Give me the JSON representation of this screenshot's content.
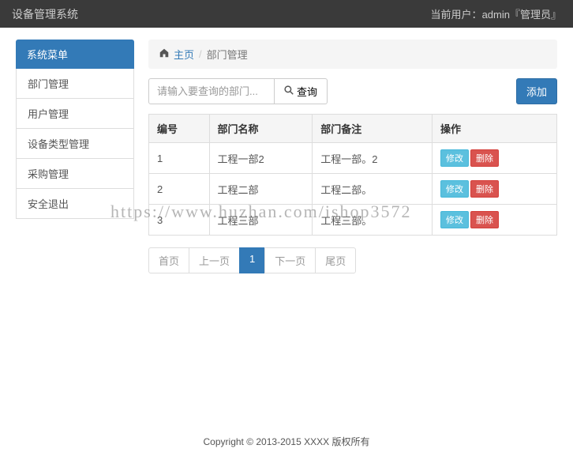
{
  "navbar": {
    "brand": "设备管理系统",
    "user_prefix": "当前用户：",
    "user_name": "admin",
    "user_role": "『管理员』"
  },
  "sidebar": {
    "header": "系统菜单",
    "items": [
      {
        "label": "部门管理"
      },
      {
        "label": "用户管理"
      },
      {
        "label": "设备类型管理"
      },
      {
        "label": "采购管理"
      },
      {
        "label": "安全退出"
      }
    ]
  },
  "breadcrumb": {
    "home": "主页",
    "current": "部门管理"
  },
  "search": {
    "placeholder": "请输入要查询的部门...",
    "button": "查询"
  },
  "actions": {
    "add": "添加",
    "edit": "修改",
    "delete": "删除"
  },
  "table": {
    "headers": {
      "id": "编号",
      "name": "部门名称",
      "remark": "部门备注",
      "op": "操作"
    },
    "rows": [
      {
        "id": "1",
        "name": "工程一部2",
        "remark": "工程一部。2"
      },
      {
        "id": "2",
        "name": "工程二部",
        "remark": "工程二部。"
      },
      {
        "id": "3",
        "name": "工程三部",
        "remark": "工程三部。"
      }
    ]
  },
  "pagination": {
    "first": "首页",
    "prev": "上一页",
    "page1": "1",
    "next": "下一页",
    "last": "尾页"
  },
  "watermark": "https://www.huzhan.com/ishop3572",
  "footer": "Copyright © 2013-2015 XXXX 版权所有"
}
